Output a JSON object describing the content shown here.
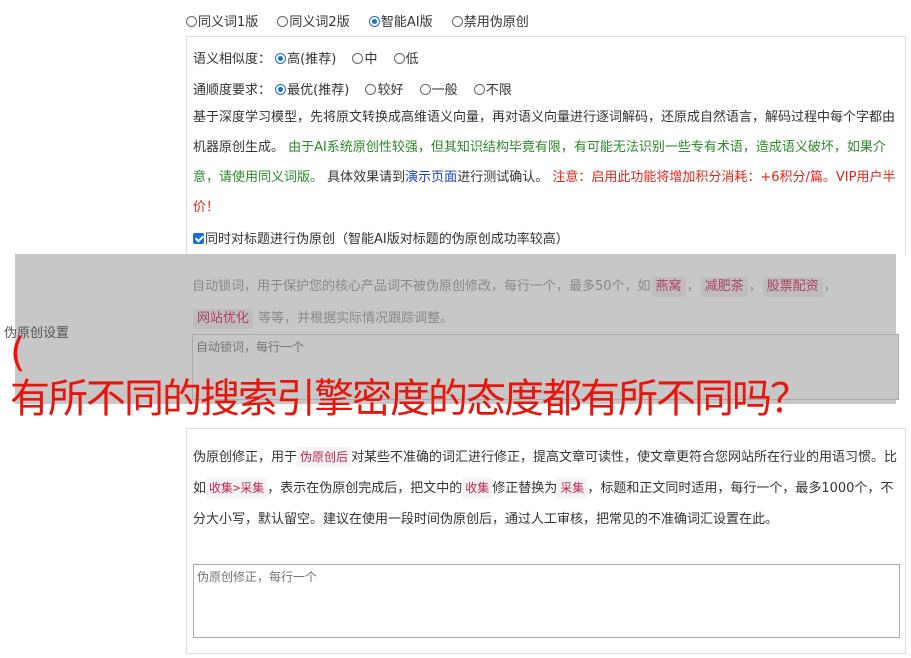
{
  "versions": {
    "options": [
      "同义词1版",
      "同义词2版",
      "智能AI版",
      "禁用伪原创"
    ],
    "selected": "智能AI版"
  },
  "similarity": {
    "label": "语义相似度：",
    "options": [
      "高(推荐)",
      "中",
      "低"
    ],
    "selected": "高(推荐)"
  },
  "fluency": {
    "label": "通顺度要求：",
    "options": [
      "最优(推荐)",
      "较好",
      "一般",
      "不限"
    ],
    "selected": "最优(推荐)"
  },
  "ai_description": {
    "part1": "基于深度学习模型，先将原文转换成高维语义向量，再对语义向量进行逐词解码，还原成自然语言，解码过程中每个字都由机器原创生成。",
    "part2_green": "由于AI系统原创性较强，但其知识结构毕竟有限，有可能无法识别一些专有术语，造成语义破坏，如果介意，请使用同义词版。",
    "part3": "具体效果请到",
    "demo_link": "演示页面",
    "part4": "进行测试确认。",
    "part5_red": "注意：启用此功能将增加积分消耗：+6积分/篇。VIP用户半价！"
  },
  "title_checkbox": {
    "label": "同时对标题进行伪原创（智能AI版对标题的伪原创成功率较高）",
    "checked": true
  },
  "lock_words": {
    "desc_start": "自动锁词，用于保护您的核心产品词不被伪原创修改，每行一个，最多50个，如",
    "tags": [
      "燕窝",
      "减肥茶",
      "股票配资",
      "网站优化"
    ],
    "tag_sep": "，",
    "desc_end": "等等，并根据实际情况跟踪调整。",
    "placeholder": "自动锁词，每行一个"
  },
  "settings_label": "伪原创设置",
  "overlay_caption": {
    "line1": "(",
    "line2": "有所不同的搜索引擎密度的态度都有所不同吗？"
  },
  "correction": {
    "t1": "伪原创修正，用于",
    "c1": "伪原创后",
    "t2": "对某些不准确的词汇进行修正，提高文章可读性，使文章更符合您网站所在行业的用语习惯。比如",
    "c2": "收集>采集",
    "t3": "，表示在伪原创完成后，把文中的",
    "c3": "收集",
    "t4": "修正替换为",
    "c4": "采集",
    "t5": "，标题和正文同时适用，每行一个，最多1000个，不分大小写，默认留空。建议在使用一段时间伪原创后，通过人工审核，把常见的不准确词汇设置在此。",
    "placeholder": "伪原创修正，每行一个"
  }
}
